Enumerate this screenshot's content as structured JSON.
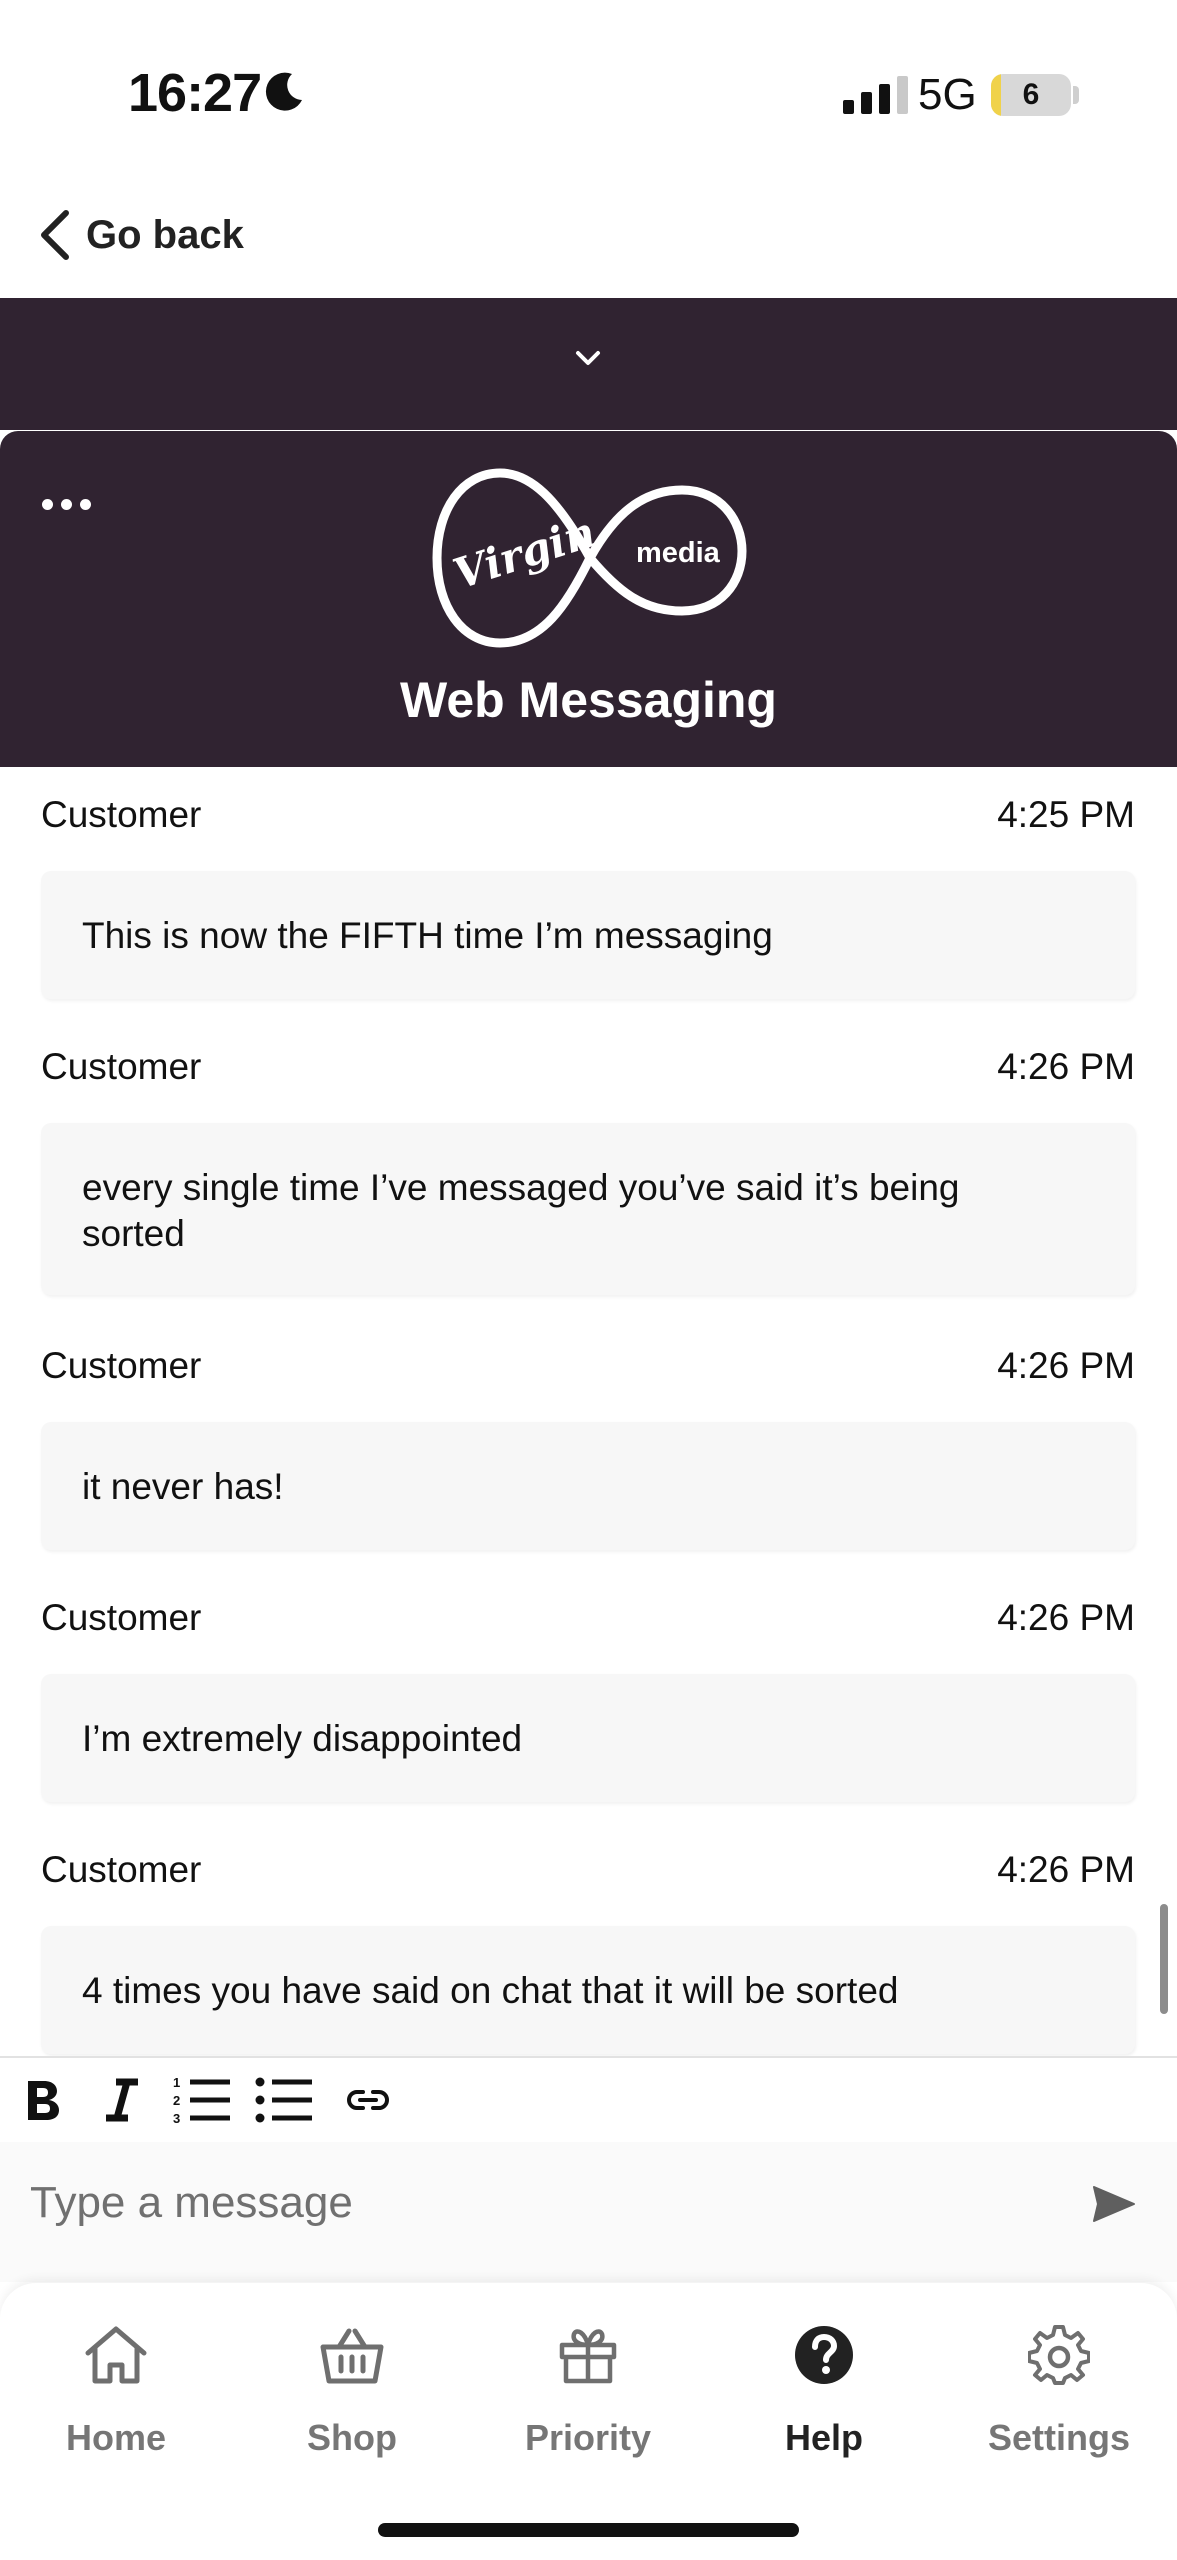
{
  "status_bar": {
    "time": "16:27",
    "network": "5G",
    "battery_level": "6",
    "battery_fraction": 0.06
  },
  "nav": {
    "back_label": "Go back"
  },
  "widget": {
    "title": "Web Messaging",
    "logo_text_1": "Virgin",
    "logo_text_2": "media",
    "header_color": "#302331"
  },
  "messages": [
    {
      "sender": "Customer",
      "time": "4:25 PM",
      "text": "This is now the FIFTH time I’m messaging"
    },
    {
      "sender": "Customer",
      "time": "4:26 PM",
      "text": "every single time I’ve messaged you’ve said it’s being sorted"
    },
    {
      "sender": "Customer",
      "time": "4:26 PM",
      "text": "it never has!"
    },
    {
      "sender": "Customer",
      "time": "4:26 PM",
      "text": "I’m extremely disappointed"
    },
    {
      "sender": "Customer",
      "time": "4:26 PM",
      "text": "4 times you have said on chat that it will be sorted"
    }
  ],
  "toolbar": {
    "icons": [
      "bold-icon",
      "italic-icon",
      "numbered-list-icon",
      "bullet-list-icon",
      "link-icon"
    ]
  },
  "compose": {
    "placeholder": "Type a message"
  },
  "bottom_nav": {
    "items": [
      {
        "label": "Home",
        "icon": "home-icon"
      },
      {
        "label": "Shop",
        "icon": "basket-icon"
      },
      {
        "label": "Priority",
        "icon": "gift-icon"
      },
      {
        "label": "Help",
        "icon": "help-icon",
        "active": true
      },
      {
        "label": "Settings",
        "icon": "gear-icon"
      }
    ]
  }
}
